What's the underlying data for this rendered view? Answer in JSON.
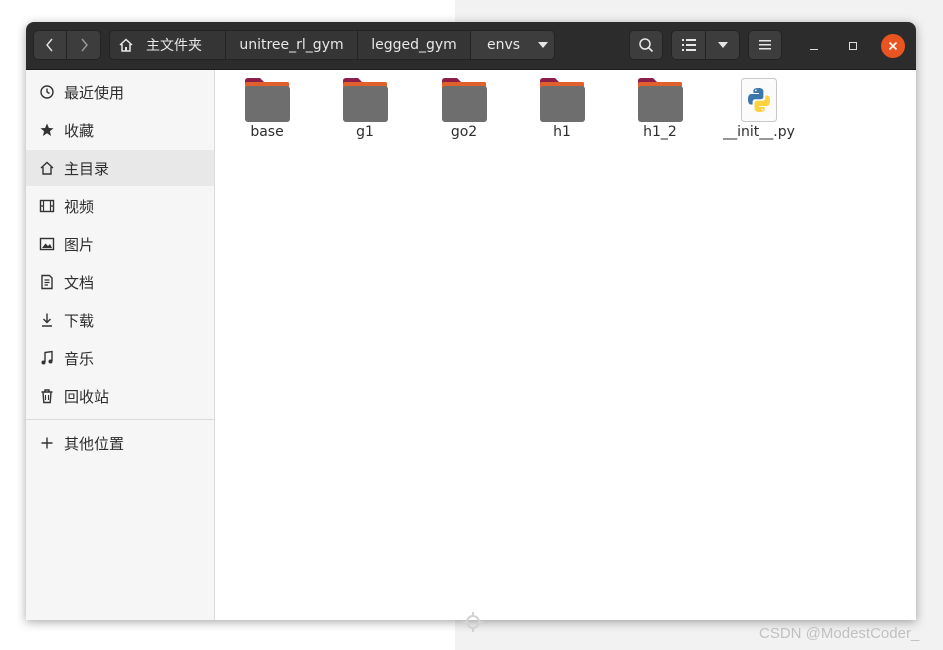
{
  "breadcrumb": {
    "home_label": "主文件夹",
    "items": [
      "unitree_rl_gym",
      "legged_gym",
      "envs"
    ]
  },
  "sidebar": {
    "items": [
      {
        "label": "最近使用",
        "icon": "clock-icon"
      },
      {
        "label": "收藏",
        "icon": "star-icon"
      },
      {
        "label": "主目录",
        "icon": "home-icon",
        "active": true
      },
      {
        "label": "视频",
        "icon": "film-icon"
      },
      {
        "label": "图片",
        "icon": "image-icon"
      },
      {
        "label": "文档",
        "icon": "document-icon"
      },
      {
        "label": "下载",
        "icon": "download-icon"
      },
      {
        "label": "音乐",
        "icon": "music-icon"
      },
      {
        "label": "回收站",
        "icon": "trash-icon"
      }
    ],
    "other_locations": {
      "label": "其他位置",
      "icon": "plus-icon"
    }
  },
  "files": [
    {
      "name": "base",
      "type": "folder"
    },
    {
      "name": "g1",
      "type": "folder"
    },
    {
      "name": "go2",
      "type": "folder"
    },
    {
      "name": "h1",
      "type": "folder"
    },
    {
      "name": "h1_2",
      "type": "folder"
    },
    {
      "name": "__init__.py",
      "type": "python-file"
    }
  ],
  "colors": {
    "headerbar": "#2c2c2c",
    "close_button": "#e95420",
    "folder_tab": "#e0612b",
    "folder_tab_dark": "#8b1e4a",
    "folder_body": "#6e6e6e"
  },
  "watermark": "CSDN @ModestCoder_"
}
